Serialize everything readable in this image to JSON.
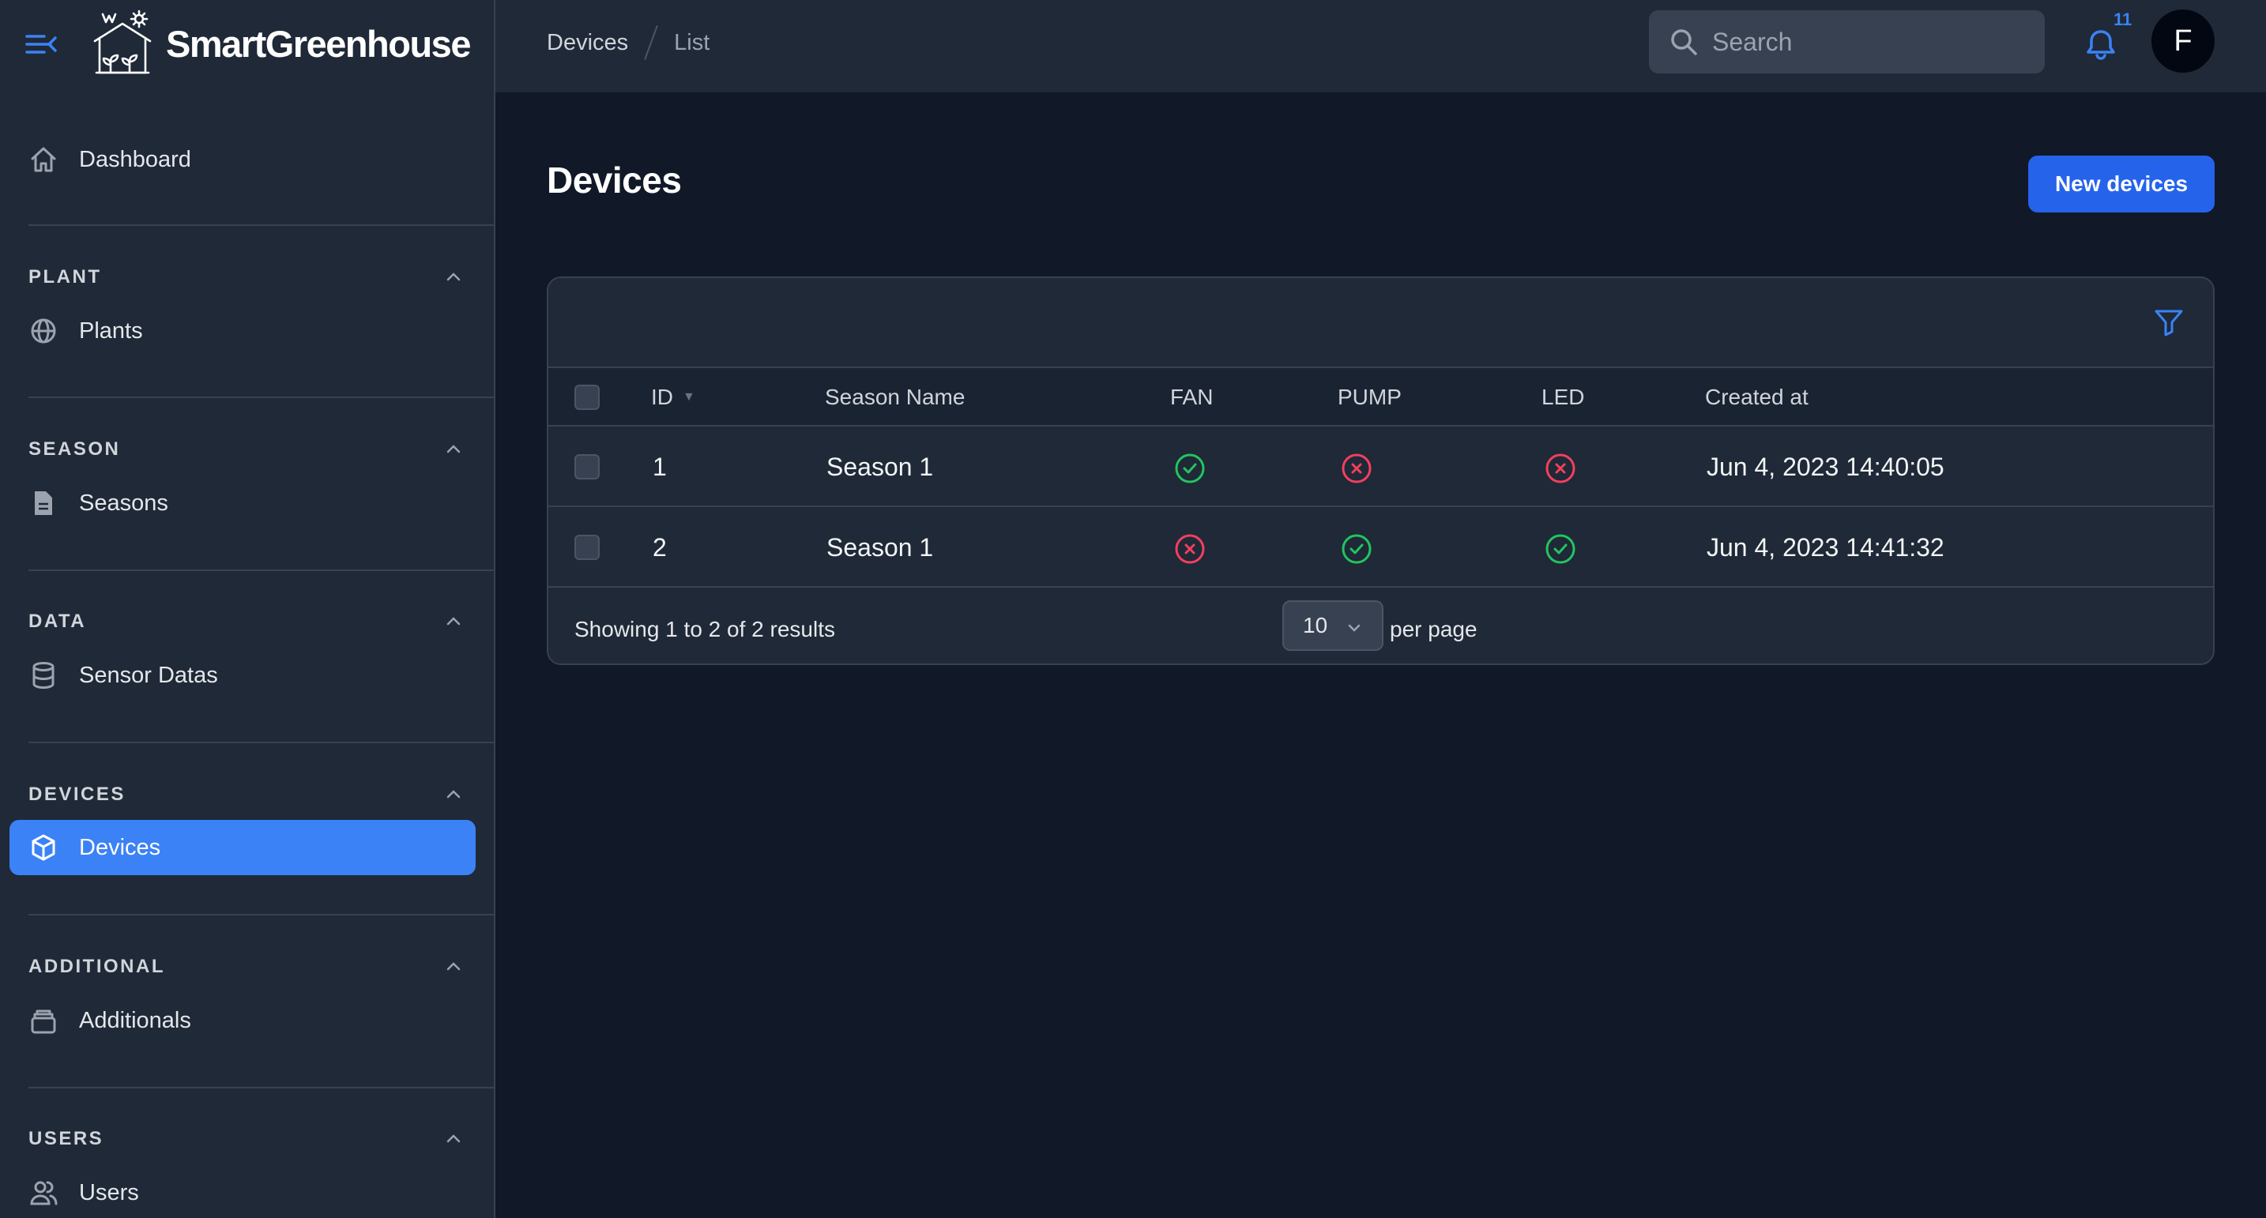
{
  "app": {
    "brand": "SmartGreenhouse"
  },
  "header": {
    "breadcrumb": [
      "Devices",
      "List"
    ],
    "search_placeholder": "Search",
    "notification_count": "11",
    "avatar_initial": "F"
  },
  "sidebar": {
    "dashboard": "Dashboard",
    "groups": [
      {
        "label": "PLANT",
        "item": "Plants",
        "icon": "globe-icon"
      },
      {
        "label": "SEASON",
        "item": "Seasons",
        "icon": "document-icon"
      },
      {
        "label": "DATA",
        "item": "Sensor Datas",
        "icon": "database-icon"
      },
      {
        "label": "DEVICES",
        "item": "Devices",
        "icon": "cube-icon",
        "active": true
      },
      {
        "label": "ADDITIONAL",
        "item": "Additionals",
        "icon": "archive-icon"
      },
      {
        "label": "USERS",
        "item": "Users",
        "icon": "users-icon"
      }
    ]
  },
  "page": {
    "title": "Devices",
    "new_button": "New devices"
  },
  "table": {
    "columns": [
      "ID",
      "Season Name",
      "FAN",
      "PUMP",
      "LED",
      "Created at"
    ],
    "rows": [
      {
        "id": "1",
        "season": "Season 1",
        "fan": true,
        "pump": false,
        "led": false,
        "created": "Jun 4, 2023 14:40:05"
      },
      {
        "id": "2",
        "season": "Season 1",
        "fan": false,
        "pump": true,
        "led": true,
        "created": "Jun 4, 2023 14:41:32"
      }
    ],
    "summary": "Showing 1 to 2 of 2 results",
    "per_page_value": "10",
    "per_page_label": "per page"
  },
  "colors": {
    "accent": "#3b82f6",
    "button": "#2563eb",
    "success": "#22c55e",
    "danger": "#f43f5e"
  }
}
